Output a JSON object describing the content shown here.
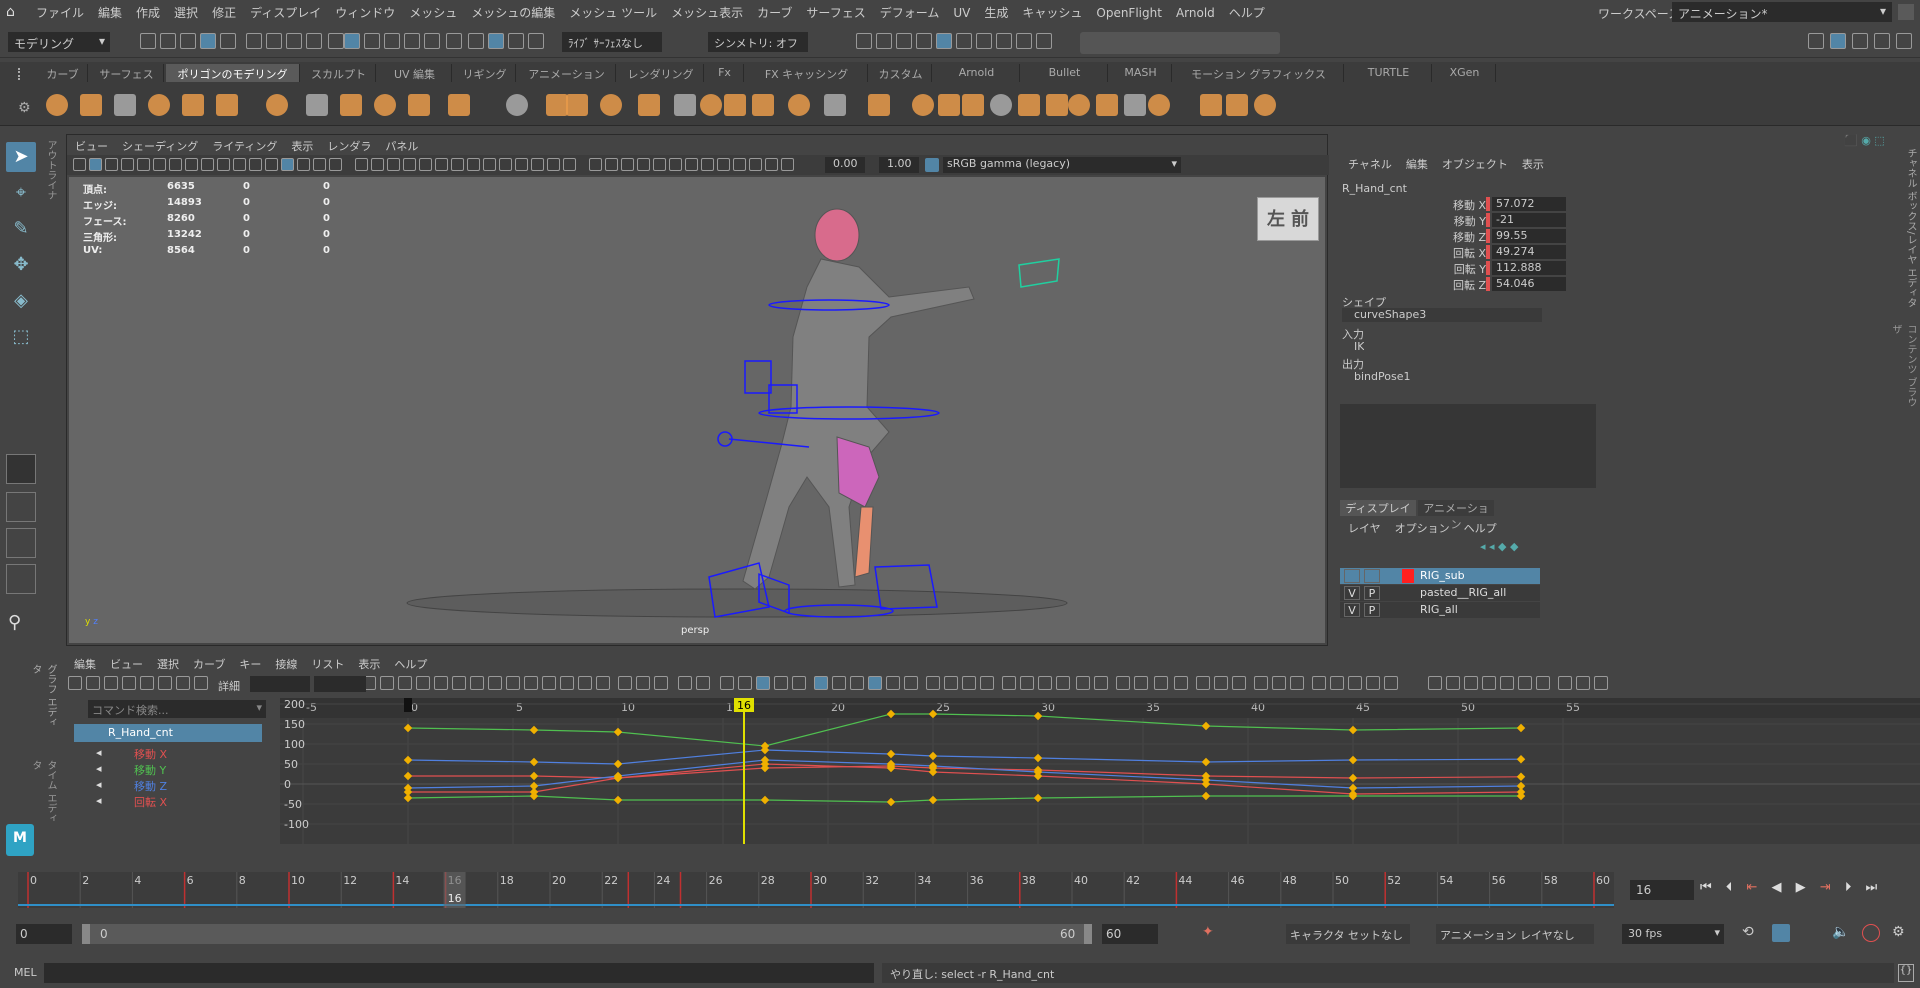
{
  "colors": {
    "bg": "#444444",
    "panel": "#3c3c3c",
    "dark": "#2b2b2b",
    "viewport": "#6a6a6a",
    "accent": "#5285a6",
    "timeline_marker": "#e0e000",
    "red": "#e05050",
    "green": "#50c050",
    "blue": "#5080e0",
    "key": "#f0b000"
  },
  "menubar": {
    "items": [
      "ファイル",
      "編集",
      "作成",
      "選択",
      "修正",
      "ディスプレイ",
      "ウィンドウ",
      "メッシュ",
      "メッシュの編集",
      "メッシュ ツール",
      "メッシュ表示",
      "カーブ",
      "サーフェス",
      "デフォーム",
      "UV",
      "生成",
      "キャッシュ",
      "OpenFlight",
      "Arnold",
      "ヘルプ"
    ],
    "workspace_label": "ワークスペース:",
    "workspace_value": "アニメーション*"
  },
  "statusline": {
    "mode": "モデリング",
    "live": "ﾗｲﾌﾞ ｻｰﾌｪｽなし",
    "symmetry": "シンメトリ: オフ"
  },
  "shelf": {
    "tabs": [
      "カーブ",
      "サーフェス",
      "ポリゴンのモデリング",
      "スカルプト",
      "UV 編集",
      "リギング",
      "アニメーション",
      "レンダリング",
      "Fx",
      "FX キャッシング",
      "カスタム",
      "Arnold",
      "Bullet",
      "MASH",
      "モーション グラフィックス",
      "TURTLE",
      "XGen"
    ],
    "active": 2
  },
  "viewport": {
    "menu": [
      "ビュー",
      "シェーディング",
      "ライティング",
      "表示",
      "レンダラ",
      "パネル"
    ],
    "exposure": "0.00",
    "gamma": "1.00",
    "colorspace": "sRGB gamma (legacy)",
    "camera": "persp",
    "viewcube_left": "左",
    "viewcube_front": "前",
    "hud": [
      {
        "label": "頂点:",
        "v": "6635",
        "a": "0",
        "b": "0"
      },
      {
        "label": "エッジ:",
        "v": "14893",
        "a": "0",
        "b": "0"
      },
      {
        "label": "フェース:",
        "v": "8260",
        "a": "0",
        "b": "0"
      },
      {
        "label": "三角形:",
        "v": "13242",
        "a": "0",
        "b": "0"
      },
      {
        "label": "UV:",
        "v": "8564",
        "a": "0",
        "b": "0"
      }
    ]
  },
  "side_tabs": {
    "outliner": "アウトライナ",
    "channel_box": "チャネル ボックス/レイヤ エディタ",
    "content": "コンテンツ ブラウザ",
    "graph": "グラフ エディタ",
    "time": "タイム エディタ"
  },
  "channelbox": {
    "menu": [
      "チャネル",
      "編集",
      "オブジェクト",
      "表示"
    ],
    "object": "R_Hand_cnt",
    "channels": [
      {
        "name": "移動 X",
        "value": "57.072"
      },
      {
        "name": "移動 Y",
        "value": "-21"
      },
      {
        "name": "移動 Z",
        "value": "99.55"
      },
      {
        "name": "回転 X",
        "value": "49.274"
      },
      {
        "name": "回転 Y",
        "value": "112.888"
      },
      {
        "name": "回転 Z",
        "value": "54.046"
      }
    ],
    "shape_h": "シェイプ",
    "shape": "curveShape3",
    "input_h": "入力",
    "input": "IK",
    "output_h": "出力",
    "output": "bindPose1"
  },
  "layers": {
    "tabs": [
      "ディスプレイ",
      "アニメーション"
    ],
    "menu": [
      "レイヤ",
      "オプション",
      "ヘルプ"
    ],
    "rows": [
      {
        "v": "",
        "p": "",
        "name": "RIG_sub"
      },
      {
        "v": "V",
        "p": "P",
        "name": "pasted__RIG_all"
      },
      {
        "v": "V",
        "p": "P",
        "name": "RIG_all"
      }
    ]
  },
  "graph": {
    "menu": [
      "編集",
      "ビュー",
      "選択",
      "カーブ",
      "キー",
      "接線",
      "リスト",
      "表示",
      "ヘルプ"
    ],
    "detail": "詳細",
    "search_placeholder": "コマンド検索...",
    "object": "R_Hand_cnt",
    "curves": [
      "移動 X",
      "移動 Y",
      "移動 Z",
      "回転 X"
    ],
    "current": "16",
    "xticks": [
      "-5",
      "0",
      "5",
      "10",
      "15",
      "20",
      "25",
      "30",
      "35",
      "40",
      "45",
      "50",
      "55"
    ],
    "yticks": [
      "200",
      "150",
      "100",
      "50",
      "0",
      "-50",
      "-100"
    ]
  },
  "timeslider": {
    "ticks": [
      "0",
      "2",
      "4",
      "6",
      "8",
      "10",
      "12",
      "14",
      "16",
      "18",
      "20",
      "22",
      "24",
      "26",
      "28",
      "30",
      "32",
      "34",
      "36",
      "38",
      "40",
      "42",
      "44",
      "46",
      "48",
      "50",
      "52",
      "54",
      "56",
      "58",
      "60"
    ],
    "current": "16",
    "field": "16"
  },
  "range": {
    "start": "0",
    "inner_start": "0",
    "inner_end": "60",
    "end": "60",
    "character": "キャラクタ セットなし",
    "anim_layer": "アニメーション レイヤなし",
    "fps": "30 fps"
  },
  "cmdline": {
    "label": "MEL",
    "result": "やり直し: select -r R_Hand_cnt"
  }
}
